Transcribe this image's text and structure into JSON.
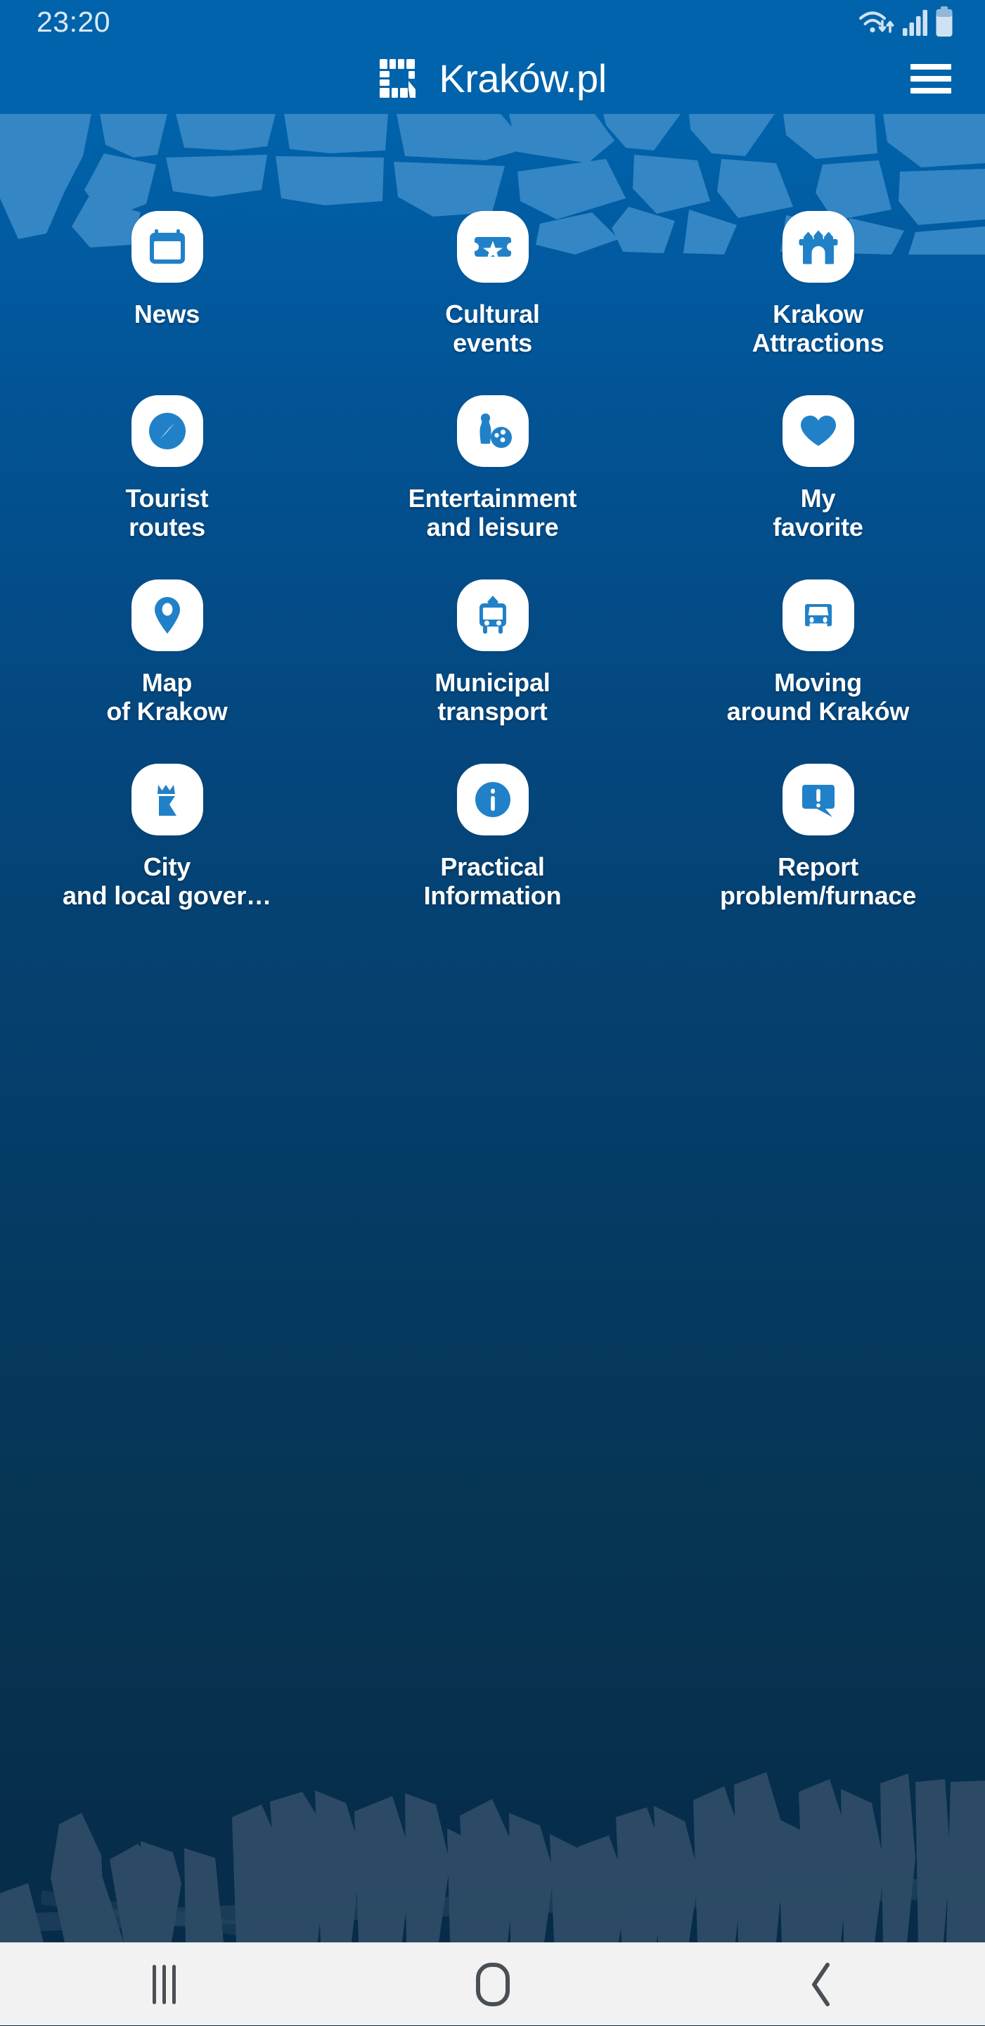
{
  "status_bar": {
    "clock": "23:20",
    "icons": [
      "wifi-icon",
      "cellular-signal-icon",
      "battery-icon"
    ]
  },
  "app_bar": {
    "brand_name": "Kraków.pl",
    "logo_icon": "krakow-square-logo-icon",
    "menu_icon": "hamburger-menu-icon",
    "background_color": "#0063ab"
  },
  "theme": {
    "gradient_top": "#0063ab",
    "gradient_bottom": "#062c49",
    "accent_blue": "#2181c8",
    "tile_background": "#ffffff",
    "label_color": "#ffffff"
  },
  "grid": {
    "tiles": [
      {
        "label": "News",
        "icon": "calendar-icon"
      },
      {
        "label": "Cultural\nevents",
        "icon": "ticket-star-icon"
      },
      {
        "label": "Krakow\nAttractions",
        "icon": "castle-icon"
      },
      {
        "label": "Tourist\nroutes",
        "icon": "compass-icon"
      },
      {
        "label": "Entertainment\nand leisure",
        "icon": "bowling-icon"
      },
      {
        "label": "My\nfavorite",
        "icon": "heart-icon"
      },
      {
        "label": "Map\nof Krakow",
        "icon": "map-pin-icon"
      },
      {
        "label": "Municipal\ntransport",
        "icon": "tram-icon"
      },
      {
        "label": "Moving\naround Kraków",
        "icon": "car-icon"
      },
      {
        "label": "City\nand local gover…",
        "icon": "crown-tower-icon"
      },
      {
        "label": "Practical\nInformation",
        "icon": "info-circle-icon"
      },
      {
        "label": "Report\nproblem/furnace",
        "icon": "alert-bubble-icon"
      }
    ]
  },
  "nav_bar": {
    "recents_label": "recents-icon",
    "home_label": "home-icon",
    "back_label": "back-icon",
    "background_color": "#f2f2f2"
  }
}
